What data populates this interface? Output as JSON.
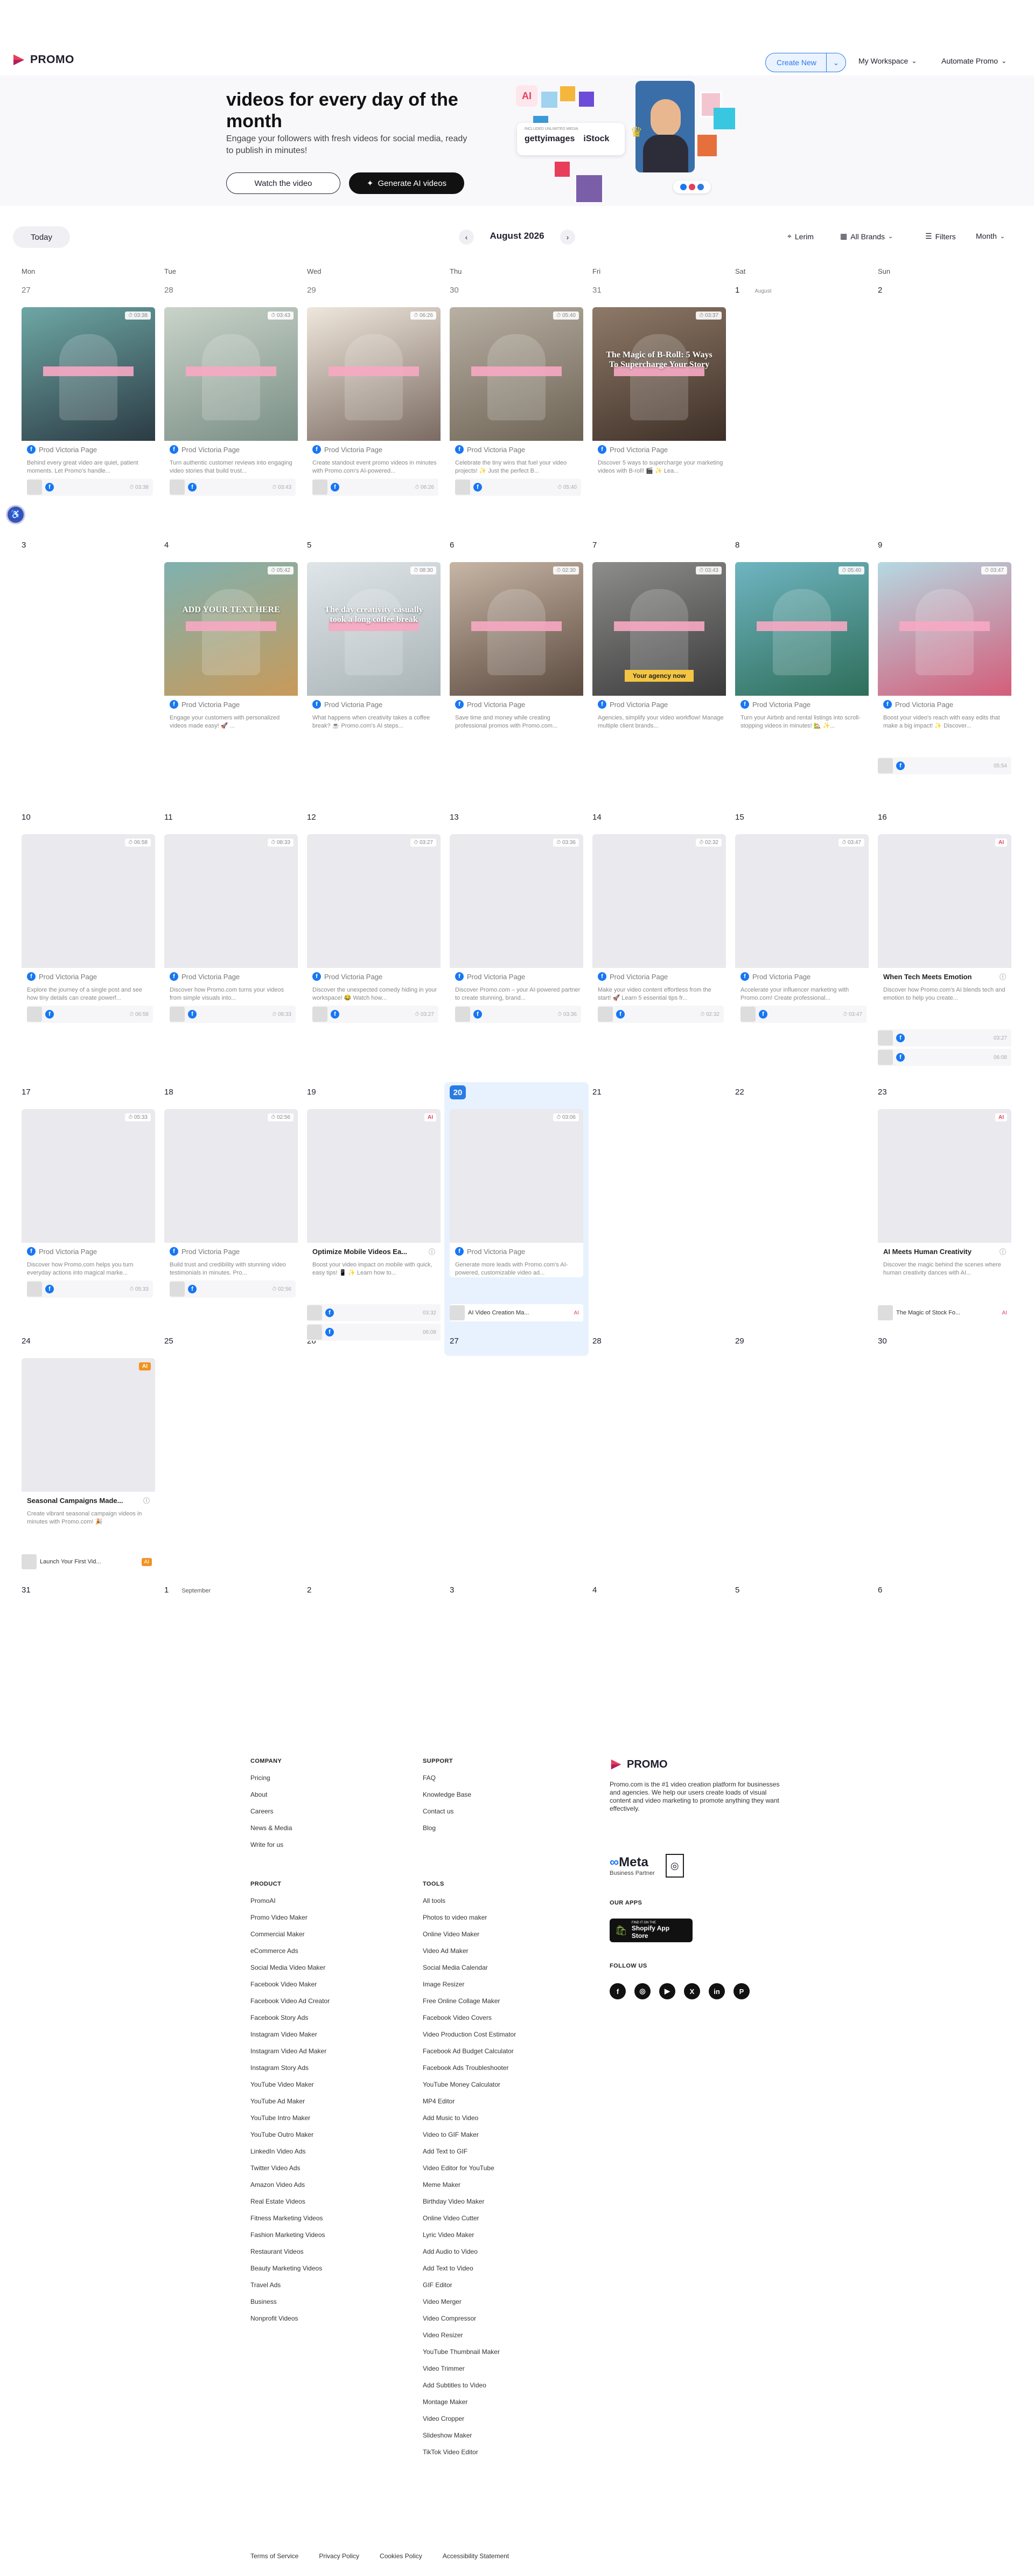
{
  "brand": {
    "name": "PROMO",
    "accent": "#e83e5a",
    "blue": "#2a7be4"
  },
  "nav": {
    "create_new": "Create New",
    "my_workspace": "My Workspace",
    "automate_promo": "Automate Promo"
  },
  "hero": {
    "title": "videos for every day of the month",
    "subtitle": "Engage your followers with fresh videos for social media, ready to publish in minutes!",
    "watch_button": "Watch the video",
    "generate_button": "Generate AI videos",
    "collage": {
      "ai": "AI",
      "getty": "gettyimages",
      "istock": "iStock",
      "included": "INCLUDED UNLIMITED MEDIA"
    }
  },
  "toolbar": {
    "today": "Today",
    "month_label": "August 2026",
    "location": "Lerim",
    "brands": "All Brands",
    "filters": "Filters",
    "view": "Month"
  },
  "weekdays": [
    "Mon",
    "Tue",
    "Wed",
    "Thu",
    "Fri",
    "Sat",
    "Sun"
  ],
  "calendar": {
    "page_name": "Prod Victoria Page",
    "sep_label": "September",
    "aug_label": "August",
    "cards": {
      "c27": {
        "time": "03:38",
        "desc": "Behind every great video are quiet, patient moments. Let Promo's handle..."
      },
      "c28": {
        "time": "03:43",
        "desc": "Turn authentic customer reviews into engaging video stories that build trust..."
      },
      "c29": {
        "time": "06:26",
        "desc": "Create standout event promo videos in minutes with Promo.com's AI-powered..."
      },
      "c30": {
        "time": "05:40",
        "desc": "Celebrate the tiny wins that fuel your video projects! ✨ Just the perfect B..."
      },
      "c31": {
        "time": "03:37",
        "desc": "Discover 5 ways to supercharge your marketing videos with B-roll! 🎬 ✨ Lea...",
        "overlay": "The Magic of B-Roll: 5 Ways To Supercharge Your Story"
      },
      "c4": {
        "time": "05:42",
        "desc": "Engage your customers with personalized videos made easy! 🚀 ...",
        "overlay": "ADD YOUR TEXT HERE"
      },
      "c5": {
        "time": "08:30",
        "desc": "What happens when creativity takes a coffee break? ☕ Promo.com's AI steps...",
        "overlay": "The day creativity casually took a long coffee break"
      },
      "c6": {
        "time": "02:30",
        "desc": "Save time and money while creating professional promos with Promo.com..."
      },
      "c7": {
        "time": "03:43",
        "desc": "Agencies, simplify your video workflow! Manage multiple client brands...",
        "overlay": "Your agency now"
      },
      "c8": {
        "time": "05:40",
        "desc": "Turn your Airbnb and rental listings into scroll-stopping videos in minutes! 🏡 ✨..."
      },
      "c9": {
        "time": "03:47",
        "desc": "Boost your video's reach with easy edits that make a big impact! ✨ Discover..."
      },
      "c10": {
        "time": "06:58",
        "desc": "Explore the journey of a single post and see how tiny details can create powerf..."
      },
      "c11": {
        "time": "08:33",
        "desc": "Discover how Promo.com turns your videos from simple visuals into..."
      },
      "c12": {
        "time": "03:27",
        "desc": "Discover the unexpected comedy hiding in your workspace! 😂 Watch how..."
      },
      "c13": {
        "time": "03:36",
        "desc": "Discover Promo.com – your AI-powered partner to create stunning, brand..."
      },
      "c14": {
        "time": "02:32",
        "desc": "Make your video content effortless from the start! 🚀 Learn 5 essential tips fr..."
      },
      "c15": {
        "time": "03:47",
        "desc": "Accelerate your influencer marketing with Promo.com! Create professional..."
      },
      "c16": {
        "ai": "AI",
        "title": "When Tech Meets Emotion",
        "desc": "Discover how Promo.com's AI blends tech and emotion to help you create..."
      },
      "c17": {
        "time": "05:33",
        "desc": "Discover how Promo.com helps you turn everyday actions into magical marke..."
      },
      "c18": {
        "time": "02:56",
        "desc": "Build trust and credibility with stunning video testimonials in minutes. Pro..."
      },
      "c19": {
        "ai": "AI",
        "title": "Optimize Mobile Videos Ea...",
        "desc": "Boost your video impact on mobile with quick, easy tips! 📱 ✨ Learn how to..."
      },
      "c20": {
        "time": "03:06",
        "desc": "Generate more leads with Promo.com's AI-powered, customizable video ad...",
        "sub": "AI Video Creation Ma..."
      },
      "c23": {
        "ai": "AI",
        "title": "AI Meets Human Creativity",
        "desc": "Discover the magic behind the scenes where human creativity dances with AI...",
        "sub": "The Magic of Stock Fo..."
      },
      "c24": {
        "ai": "AI",
        "title": "Seasonal Campaigns Made...",
        "desc": "Create vibrant seasonal campaign videos in minutes with Promo.com! 🎉",
        "sub": "Launch Your First Vid..."
      }
    },
    "extra_times": {
      "e9": "05:54",
      "e16a": "03:27",
      "e16b": "06:08",
      "e17": "05:38",
      "e18": "05:38",
      "e19a": "03:32",
      "e19b": "06:08"
    }
  },
  "footer": {
    "company": {
      "head": "COMPANY",
      "links": [
        "Pricing",
        "About",
        "Careers",
        "News & Media",
        "Write for us"
      ]
    },
    "support": {
      "head": "SUPPORT",
      "links": [
        "FAQ",
        "Knowledge Base",
        "Contact us",
        "Blog"
      ]
    },
    "product": {
      "head": "PRODUCT",
      "links": [
        "PromoAI",
        "Promo Video Maker",
        "Commercial Maker",
        "eCommerce Ads",
        "Social Media Video Maker",
        "Facebook Video Maker",
        "Facebook Video Ad Creator",
        "Facebook Story Ads",
        "Instagram Video Maker",
        "Instagram Video Ad Maker",
        "Instagram Story Ads",
        "YouTube Video Maker",
        "YouTube Ad Maker",
        "YouTube Intro Maker",
        "YouTube Outro Maker",
        "LinkedIn Video Ads",
        "Twitter Video Ads",
        "Amazon Video Ads",
        "Real Estate Videos",
        "Fitness Marketing Videos",
        "Fashion Marketing Videos",
        "Restaurant Videos",
        "Beauty Marketing Videos",
        "Travel Ads",
        "Business",
        "Nonprofit Videos"
      ]
    },
    "tools": {
      "head": "TOOLS",
      "links": [
        "All tools",
        "Photos to video maker",
        "Online Video Maker",
        "Video Ad Maker",
        "Social Media Calendar",
        "Image Resizer",
        "Free Online Collage Maker",
        "Facebook Video Covers",
        "Video Production Cost Estimator",
        "Facebook Ad Budget Calculator",
        "Facebook Ads Troubleshooter",
        "YouTube Money Calculator",
        "MP4 Editor",
        "Add Music to Video",
        "Video to GIF Maker",
        "Add Text to GIF",
        "Video Editor for YouTube",
        "Meme Maker",
        "Birthday Video Maker",
        "Online Video Cutter",
        "Lyric Video Maker",
        "Add Audio to Video",
        "Add Text to Video",
        "GIF Editor",
        "Video Merger",
        "Video Compressor",
        "Video Resizer",
        "YouTube Thumbnail Maker",
        "Video Trimmer",
        "Add Subtitles to Video",
        "Montage Maker",
        "Video Cropper",
        "Slideshow Maker",
        "TikTok Video Editor"
      ]
    },
    "about": "Promo.com is the #1 video creation platform for businesses and agencies. We help our users create loads of visual content and video marketing to promote anything they want effectively.",
    "meta": "Meta",
    "business_partner": "Business Partner",
    "our_apps": "OUR APPS",
    "shopify": "Shopify App Store",
    "shopify_small": "FIND IT ON THE",
    "follow_us": "FOLLOW US",
    "social": [
      "f",
      "◎",
      "▶",
      "X",
      "in",
      "P"
    ],
    "bottom": [
      "Terms of Service",
      "Privacy Policy",
      "Cookies Policy",
      "Accessibility Statement"
    ]
  }
}
